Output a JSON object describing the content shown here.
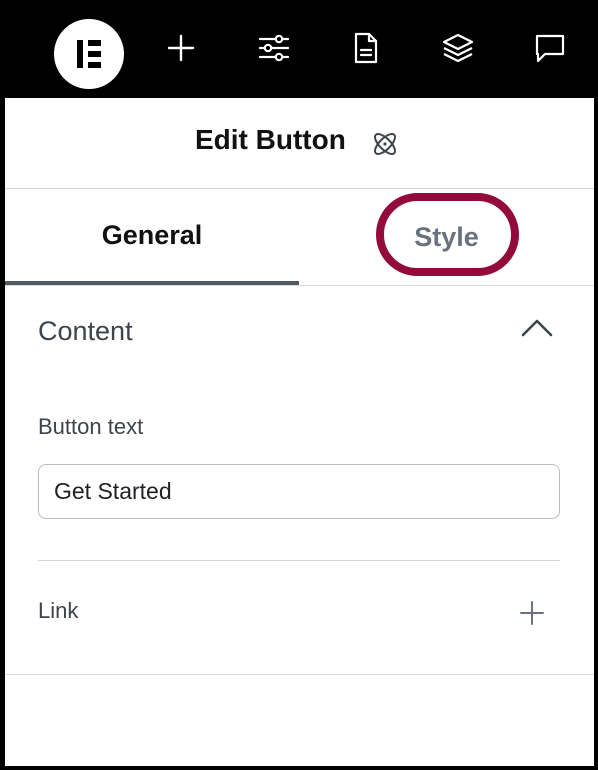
{
  "topbar": {
    "icons": [
      "elementor-logo-icon",
      "add-icon",
      "settings-sliders-icon",
      "page-document-icon",
      "layers-icon",
      "comment-icon"
    ]
  },
  "header": {
    "title": "Edit Button",
    "icon": "atom-icon"
  },
  "tabs": [
    {
      "label": "General",
      "active": true
    },
    {
      "label": "Style",
      "active": false
    }
  ],
  "highlight_color": "#920b3a",
  "section": {
    "title": "Content",
    "expanded": true
  },
  "fields": {
    "button_text_label": "Button text",
    "button_text_value": "Get Started",
    "link_label": "Link"
  }
}
